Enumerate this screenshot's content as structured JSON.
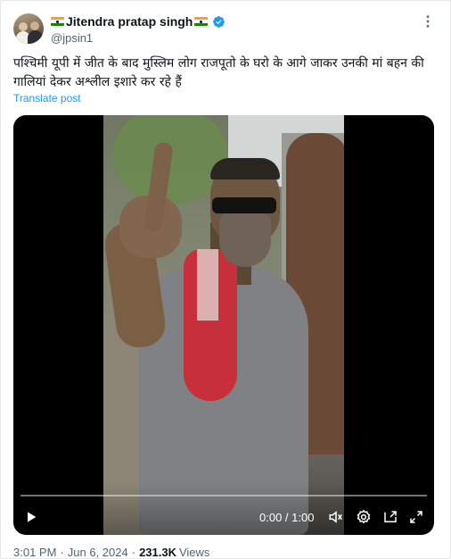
{
  "author": {
    "display_name": "Jitendra pratap singh",
    "handle": "@jpsin1"
  },
  "tweet": {
    "text": "पश्चिमी यूपी में जीत के बाद मुस्लिम लोग राजपूतो के घरो  के आगे जाकर उनकी मां बहन की गालियां देकर अश्लील इशारे  कर रहे हैं",
    "translate_label": "Translate post"
  },
  "video": {
    "time": "0:00 / 1:00",
    "progress": 0
  },
  "meta": {
    "time": "3:01 PM",
    "separator": "·",
    "date": "Jun 6, 2024",
    "views_count": "231.3K",
    "views_label": "Views"
  },
  "icons": [
    "india-flag-icon",
    "verified-badge-icon",
    "more-icon",
    "play-icon",
    "volume-icon",
    "settings-icon",
    "pip-icon",
    "fullscreen-icon"
  ],
  "colors": {
    "link": "#1d9bf0",
    "verified": "#1d9bf0",
    "secondary_text": "#536471",
    "primary_text": "#0f1419"
  }
}
